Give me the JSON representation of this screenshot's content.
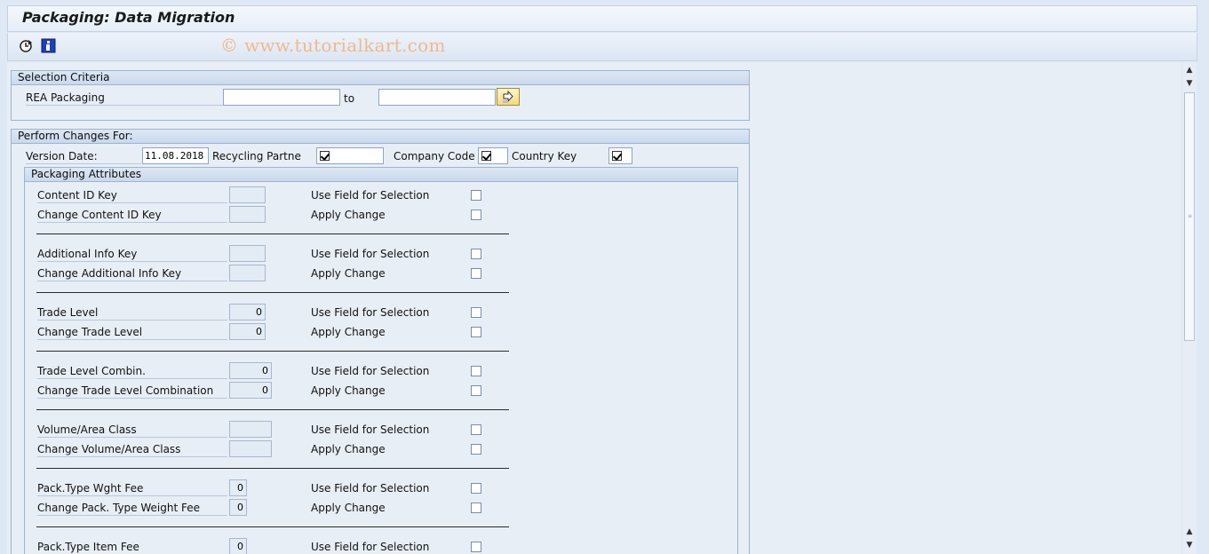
{
  "window": {
    "title": "Packaging: Data Migration"
  },
  "toolbar": {
    "icons": [
      "execute-clock-icon",
      "info-icon"
    ],
    "watermark": "© www.tutorialkart.com"
  },
  "selection": {
    "header": "Selection Criteria",
    "rea_label": "REA Packaging",
    "from_value": "",
    "to_label": "to",
    "to_value": ""
  },
  "perform": {
    "header": "Perform Changes For:",
    "version_label": "Version Date:",
    "version_value": "11.08.2018",
    "recycling_label": "Recycling Partne",
    "company_label": "Company Code",
    "country_label": "Country Key",
    "checked": {
      "recycling": true,
      "company": true,
      "country": true
    }
  },
  "attributes": {
    "header": "Packaging Attributes",
    "use_label": "Use Field for Selection",
    "apply_label": "Apply Change",
    "groups": [
      {
        "label1": "Content ID Key",
        "value1": "",
        "label2": "Change Content ID Key",
        "value2": ""
      },
      {
        "label1": "Additional Info Key",
        "value1": "",
        "label2": "Change Additional Info Key",
        "value2": ""
      },
      {
        "label1": "Trade Level",
        "value1": "0",
        "label2": "Change Trade Level",
        "value2": "0"
      },
      {
        "label1": "Trade Level Combin.",
        "value1": "0",
        "label2": "Change Trade Level Combination",
        "value2": "0"
      },
      {
        "label1": "Volume/Area Class",
        "value1": "",
        "label2": "Change Volume/Area Class",
        "value2": ""
      },
      {
        "label1": "Pack.Type Wght Fee",
        "value1": "0",
        "label2": "Change Pack. Type Weight Fee",
        "value2": "0"
      },
      {
        "label1": "Pack.Type Item Fee",
        "value1": "0"
      }
    ]
  },
  "scrollbar": {
    "up": "▲",
    "down": "▼"
  }
}
